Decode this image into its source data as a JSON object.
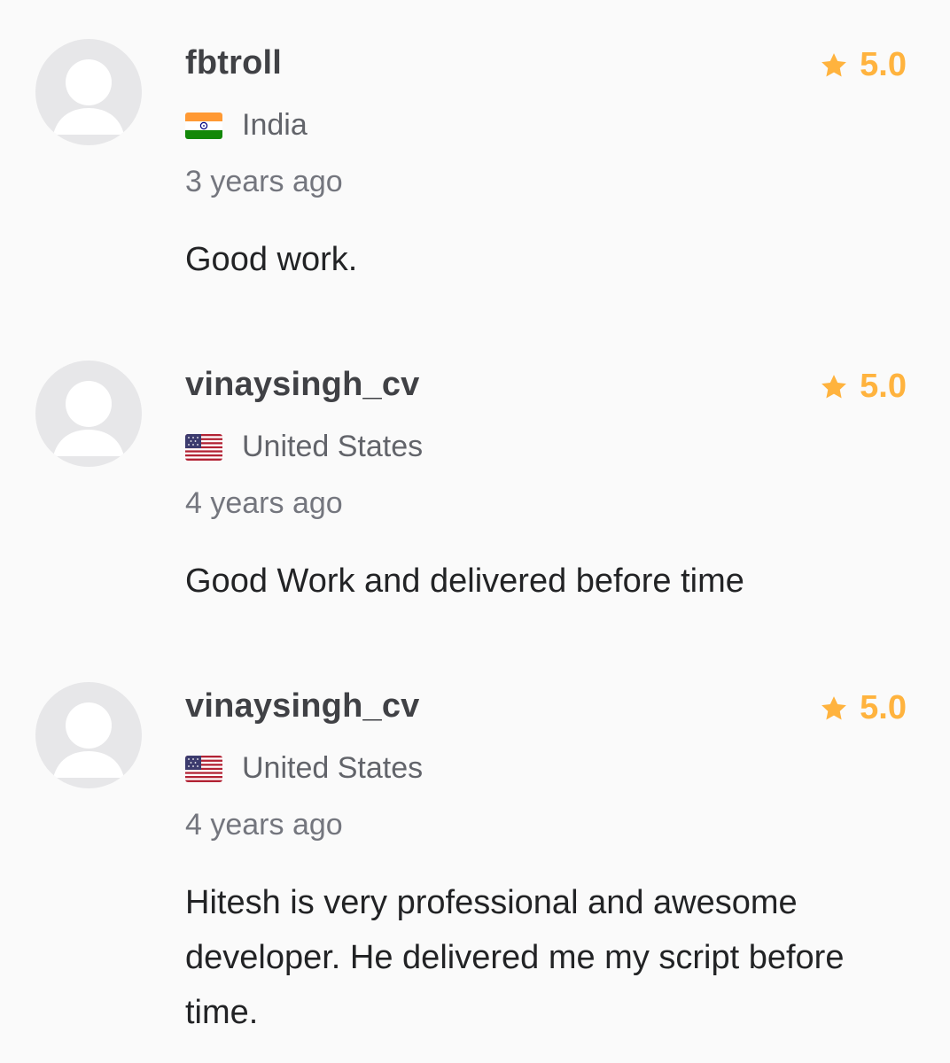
{
  "colors": {
    "star": "#ffb33e",
    "avatar_bg": "#e7e7e9",
    "avatar_fg": "#ffffff",
    "username": "#404145",
    "secondary_text": "#74767e"
  },
  "reviews": [
    {
      "username": "fbtroll",
      "rating": "5.0",
      "country": "India",
      "flag_icon": "india-flag-icon",
      "time": "3 years ago",
      "comment": "Good work."
    },
    {
      "username": "vinaysingh_cv",
      "rating": "5.0",
      "country": "United States",
      "flag_icon": "us-flag-icon",
      "time": "4 years ago",
      "comment": "Good Work and delivered before time"
    },
    {
      "username": "vinaysingh_cv",
      "rating": "5.0",
      "country": "United States",
      "flag_icon": "us-flag-icon",
      "time": "4 years ago",
      "comment": "Hitesh is very professional and awesome developer. He delivered me my script before time."
    }
  ]
}
